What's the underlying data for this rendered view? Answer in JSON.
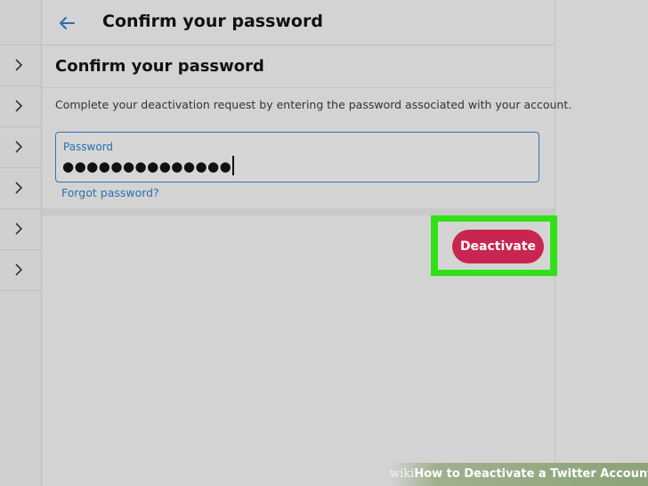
{
  "header": {
    "title": "Confirm your password"
  },
  "section": {
    "title": "Confirm your password",
    "description": "Complete your deactivation request by entering the password associated with your account."
  },
  "password": {
    "label": "Password",
    "masked_value": "●●●●●●●●●●●●●●"
  },
  "forgot_password_link": "Forgot password?",
  "deactivate_button": "Deactivate",
  "watermark": {
    "wiki": "wiki",
    "how": "How",
    "rest": " to Deactivate a Twitter Account"
  },
  "colors": {
    "accent_blue": "#2a6fb0",
    "button_red": "#c8264e",
    "highlight_green": "#32e01a"
  },
  "icons": {
    "back": "arrow-left-icon",
    "sidebar": "chevron-right-icon"
  }
}
